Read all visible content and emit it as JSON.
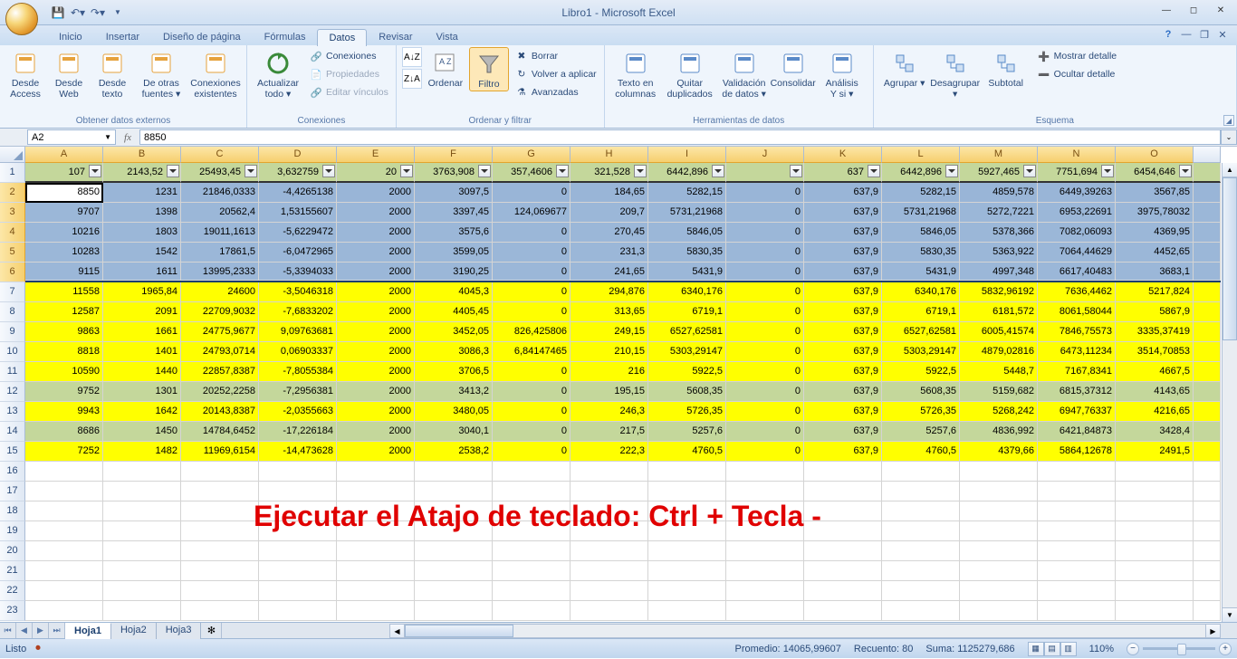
{
  "window": {
    "title": "Libro1 - Microsoft Excel"
  },
  "ribbon": {
    "tabs": [
      "Inicio",
      "Insertar",
      "Diseño de página",
      "Fórmulas",
      "Datos",
      "Revisar",
      "Vista"
    ],
    "active_tab_index": 4,
    "groups": {
      "obtener": {
        "title": "Obtener datos externos",
        "btns": [
          "Desde\nAccess",
          "Desde\nWeb",
          "Desde\ntexto",
          "De otras\nfuentes ▾",
          "Conexiones\nexistentes"
        ]
      },
      "conexiones": {
        "title": "Conexiones",
        "actualizar": "Actualizar\ntodo ▾",
        "items": [
          "Conexiones",
          "Propiedades",
          "Editar vínculos"
        ]
      },
      "ordenar": {
        "title": "Ordenar y filtrar",
        "ordenar": "Ordenar",
        "filtro": "Filtro",
        "items": [
          "Borrar",
          "Volver a aplicar",
          "Avanzadas"
        ]
      },
      "datatools": {
        "title": "Herramientas de datos",
        "btns": [
          "Texto en\ncolumnas",
          "Quitar\nduplicados",
          "Validación\nde datos ▾",
          "Consolidar",
          "Análisis\nY si ▾"
        ]
      },
      "esquema": {
        "title": "Esquema",
        "btns": [
          "Agrupar ▾",
          "Desagrupar ▾",
          "Subtotal"
        ],
        "items": [
          "Mostrar detalle",
          "Ocultar detalle"
        ]
      }
    }
  },
  "formula_bar": {
    "name_box": "A2",
    "formula": "8850"
  },
  "columns": [
    "A",
    "B",
    "C",
    "D",
    "E",
    "F",
    "G",
    "H",
    "I",
    "J",
    "K",
    "L",
    "M",
    "N",
    "O"
  ],
  "selected_cols": [
    "A",
    "B",
    "C",
    "D",
    "E",
    "F",
    "G",
    "H",
    "I",
    "J",
    "K",
    "L",
    "M",
    "N",
    "O"
  ],
  "selected_rows": [
    2,
    3,
    4,
    5,
    6
  ],
  "row_count": 23,
  "overlay_text": "Ejecutar el Atajo de teclado: Ctrl + Tecla -",
  "chart_data": {
    "type": "table",
    "columns": [
      "A",
      "B",
      "C",
      "D",
      "E",
      "F",
      "G",
      "H",
      "I",
      "J",
      "K",
      "L",
      "M",
      "N",
      "O"
    ],
    "rows": [
      {
        "style": "header",
        "filter": true,
        "values": [
          "107",
          "2143,52",
          "25493,45",
          "3,632759",
          "20",
          "3763,908",
          "357,4606",
          "321,528",
          "6442,896",
          "",
          "637",
          "6442,896",
          "5927,465",
          "7751,694",
          "6454,646"
        ]
      },
      {
        "style": "selblue first",
        "active_col": 0,
        "values": [
          "8850",
          "1231",
          "21846,0333",
          "-4,4265138",
          "2000",
          "3097,5",
          "0",
          "184,65",
          "5282,15",
          "0",
          "637,9",
          "5282,15",
          "4859,578",
          "6449,39263",
          "3567,85"
        ]
      },
      {
        "style": "selblue",
        "values": [
          "9707",
          "1398",
          "20562,4",
          "1,53155607",
          "2000",
          "3397,45",
          "124,069677",
          "209,7",
          "5731,21968",
          "0",
          "637,9",
          "5731,21968",
          "5272,7221",
          "6953,22691",
          "3975,78032"
        ]
      },
      {
        "style": "selblue",
        "values": [
          "10216",
          "1803",
          "19011,1613",
          "-5,6229472",
          "2000",
          "3575,6",
          "0",
          "270,45",
          "5846,05",
          "0",
          "637,9",
          "5846,05",
          "5378,366",
          "7082,06093",
          "4369,95"
        ]
      },
      {
        "style": "selblue",
        "values": [
          "10283",
          "1542",
          "17861,5",
          "-6,0472965",
          "2000",
          "3599,05",
          "0",
          "231,3",
          "5830,35",
          "0",
          "637,9",
          "5830,35",
          "5363,922",
          "7064,44629",
          "4452,65"
        ]
      },
      {
        "style": "selblue last",
        "values": [
          "9115",
          "1611",
          "13995,2333",
          "-5,3394033",
          "2000",
          "3190,25",
          "0",
          "241,65",
          "5431,9",
          "0",
          "637,9",
          "5431,9",
          "4997,348",
          "6617,40483",
          "3683,1"
        ]
      },
      {
        "style": "yellow",
        "values": [
          "11558",
          "1965,84",
          "24600",
          "-3,5046318",
          "2000",
          "4045,3",
          "0",
          "294,876",
          "6340,176",
          "0",
          "637,9",
          "6340,176",
          "5832,96192",
          "7636,4462",
          "5217,824"
        ]
      },
      {
        "style": "yellow",
        "values": [
          "12587",
          "2091",
          "22709,9032",
          "-7,6833202",
          "2000",
          "4405,45",
          "0",
          "313,65",
          "6719,1",
          "0",
          "637,9",
          "6719,1",
          "6181,572",
          "8061,58044",
          "5867,9"
        ]
      },
      {
        "style": "yellow",
        "values": [
          "9863",
          "1661",
          "24775,9677",
          "9,09763681",
          "2000",
          "3452,05",
          "826,425806",
          "249,15",
          "6527,62581",
          "0",
          "637,9",
          "6527,62581",
          "6005,41574",
          "7846,75573",
          "3335,37419"
        ]
      },
      {
        "style": "yellow",
        "values": [
          "8818",
          "1401",
          "24793,0714",
          "0,06903337",
          "2000",
          "3086,3",
          "6,84147465",
          "210,15",
          "5303,29147",
          "0",
          "637,9",
          "5303,29147",
          "4879,02816",
          "6473,11234",
          "3514,70853"
        ]
      },
      {
        "style": "yellow",
        "values": [
          "10590",
          "1440",
          "22857,8387",
          "-7,8055384",
          "2000",
          "3706,5",
          "0",
          "216",
          "5922,5",
          "0",
          "637,9",
          "5922,5",
          "5448,7",
          "7167,8341",
          "4667,5"
        ]
      },
      {
        "style": "olive",
        "values": [
          "9752",
          "1301",
          "20252,2258",
          "-7,2956381",
          "2000",
          "3413,2",
          "0",
          "195,15",
          "5608,35",
          "0",
          "637,9",
          "5608,35",
          "5159,682",
          "6815,37312",
          "4143,65"
        ]
      },
      {
        "style": "yellow",
        "values": [
          "9943",
          "1642",
          "20143,8387",
          "-2,0355663",
          "2000",
          "3480,05",
          "0",
          "246,3",
          "5726,35",
          "0",
          "637,9",
          "5726,35",
          "5268,242",
          "6947,76337",
          "4216,65"
        ]
      },
      {
        "style": "olive",
        "values": [
          "8686",
          "1450",
          "14784,6452",
          "-17,226184",
          "2000",
          "3040,1",
          "0",
          "217,5",
          "5257,6",
          "0",
          "637,9",
          "5257,6",
          "4836,992",
          "6421,84873",
          "3428,4"
        ]
      },
      {
        "style": "yellow",
        "values": [
          "7252",
          "1482",
          "11969,6154",
          "-14,473628",
          "2000",
          "2538,2",
          "0",
          "222,3",
          "4760,5",
          "0",
          "637,9",
          "4760,5",
          "4379,66",
          "5864,12678",
          "2491,5"
        ]
      }
    ]
  },
  "sheets": {
    "tabs": [
      "Hoja1",
      "Hoja2",
      "Hoja3"
    ],
    "active": 0
  },
  "statusbar": {
    "state": "Listo",
    "promedio_label": "Promedio:",
    "promedio": "14065,99607",
    "recuento_label": "Recuento:",
    "recuento": "80",
    "suma_label": "Suma:",
    "suma": "1125279,686",
    "zoom": "110%"
  }
}
